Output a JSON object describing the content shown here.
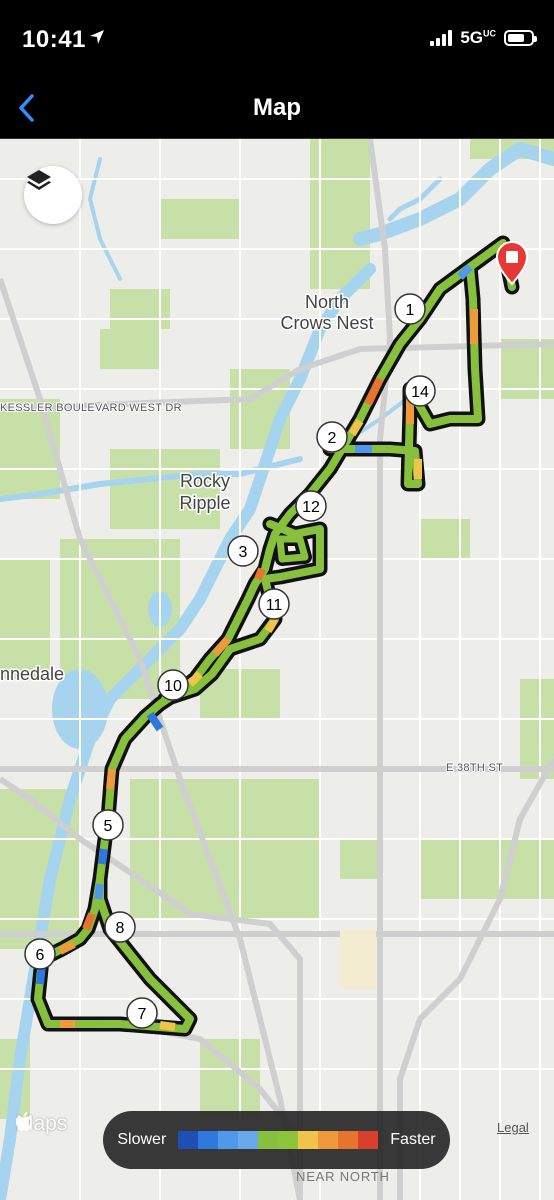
{
  "status_bar": {
    "time": "10:41",
    "network": "5G",
    "network_sup": "UC"
  },
  "nav": {
    "title": "Map",
    "back": "Back"
  },
  "map": {
    "neighborhoods": [
      {
        "name": "North",
        "id": "north"
      },
      {
        "name": "Crows Nest",
        "id": "crows-nest"
      },
      {
        "name": "Rocky",
        "id": "rocky"
      },
      {
        "name": "Ripple",
        "id": "ripple"
      },
      {
        "name": "nnedale",
        "id": "nnedale"
      }
    ],
    "streets": {
      "kessler": "KESSLER BOULEVARD WEST DR",
      "e38th": "E 38TH ST",
      "near_north": "NEAR NORTH"
    },
    "mile_markers": [
      "1",
      "2",
      "3",
      "5",
      "6",
      "7",
      "8",
      "10",
      "11",
      "12",
      "14"
    ],
    "end_marker": "end-pin",
    "colors": {
      "park": "#c6e0a8",
      "water": "#a6d3ee",
      "road": "#ffffff",
      "major_road": "#cfcfcf",
      "route_outline": "#111111",
      "pin": "#e53935"
    }
  },
  "controls": {
    "layers_icon": "layers-icon",
    "maps_brand": "Maps",
    "legal": "Legal"
  },
  "pace_legend": {
    "slower_label": "Slower",
    "faster_label": "Faster",
    "scale_colors": [
      "#1f4fb3",
      "#2f78dd",
      "#4f98ea",
      "#6aa8ec",
      "#86c03c",
      "#8cc43a",
      "#f0c44a",
      "#ec9a3a",
      "#e4742e",
      "#d8402c"
    ]
  }
}
